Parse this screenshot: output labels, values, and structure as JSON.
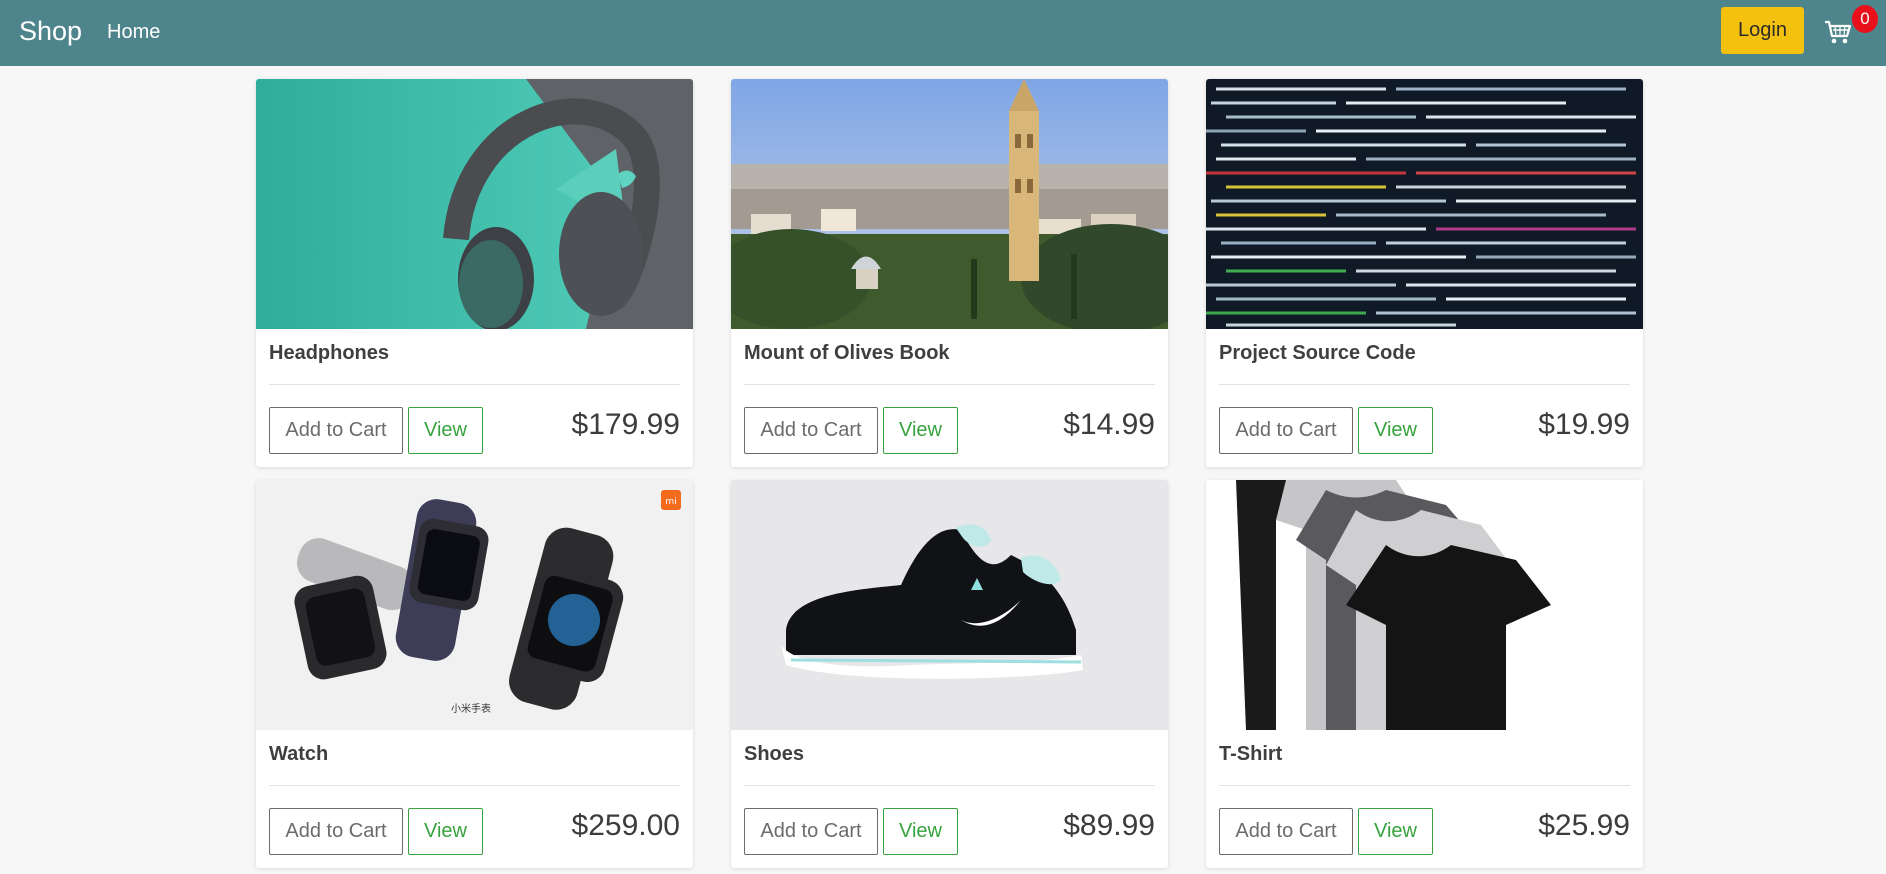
{
  "nav": {
    "brand": "Shop",
    "home": "Home",
    "login": "Login",
    "cart_count": "0"
  },
  "colors": {
    "navbar": "#4e848b",
    "login": "#f5c10f",
    "badge": "#e8111b",
    "view": "#37a33e"
  },
  "products": [
    {
      "title": "Headphones",
      "price": "$179.99",
      "add_label": "Add to Cart",
      "view_label": "View"
    },
    {
      "title": "Mount of Olives Book",
      "price": "$14.99",
      "add_label": "Add to Cart",
      "view_label": "View"
    },
    {
      "title": "Project Source Code",
      "price": "$19.99",
      "add_label": "Add to Cart",
      "view_label": "View"
    },
    {
      "title": "Watch",
      "price": "$259.00",
      "add_label": "Add to Cart",
      "view_label": "View",
      "image_caption": "小米手表"
    },
    {
      "title": "Shoes",
      "price": "$89.99",
      "add_label": "Add to Cart",
      "view_label": "View"
    },
    {
      "title": "T-Shirt",
      "price": "$25.99",
      "add_label": "Add to Cart",
      "view_label": "View"
    }
  ]
}
